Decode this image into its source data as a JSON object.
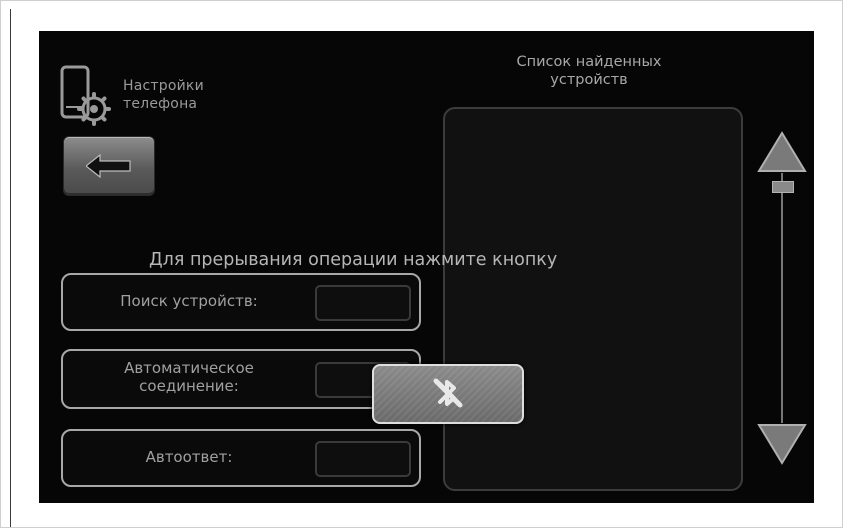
{
  "header": {
    "phone_settings_title_line1": "Настройки",
    "phone_settings_title_line2": "телефона"
  },
  "icons": {
    "phone_settings": "phone-with-gear-icon",
    "back": "arrow-left-icon",
    "cancel": "cancel-bluetooth-icon",
    "scroll_up": "triangle-up-icon",
    "scroll_down": "triangle-down-icon"
  },
  "device_list": {
    "title_line1": "Список найденных",
    "title_line2": "устройств",
    "items": []
  },
  "message": {
    "interrupt": "Для прерывания операции нажмите кнопку"
  },
  "settings": {
    "search": {
      "label": "Поиск устройств:",
      "value": ""
    },
    "auto_connect": {
      "label_line1": "Автоматическое",
      "label_line2": "соединение:",
      "value": ""
    },
    "auto_answer": {
      "label": "Автоответ:",
      "value": ""
    }
  },
  "colors": {
    "screen_background": "#060606",
    "text": "#a8a8a8",
    "button": "#6a6a6a"
  }
}
